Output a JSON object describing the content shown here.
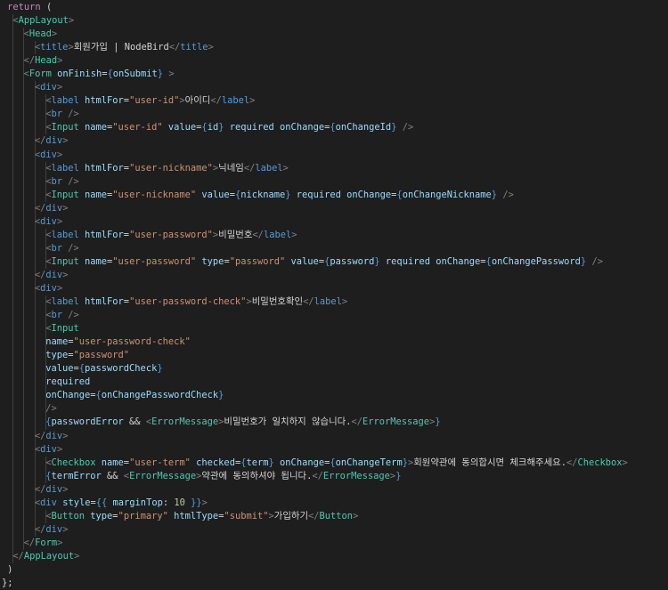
{
  "lines": [
    {
      "indent": 0.5,
      "tokens": [
        [
          "kw",
          "return"
        ],
        [
          "punc",
          " ("
        ]
      ]
    },
    {
      "indent": 1,
      "tokens": [
        [
          "ang",
          "<"
        ],
        [
          "tag",
          "AppLayout"
        ],
        [
          "ang",
          ">"
        ]
      ]
    },
    {
      "indent": 2,
      "tokens": [
        [
          "ang",
          "<"
        ],
        [
          "tag",
          "Head"
        ],
        [
          "ang",
          ">"
        ]
      ]
    },
    {
      "indent": 3,
      "tokens": [
        [
          "ang",
          "<"
        ],
        [
          "htag",
          "title"
        ],
        [
          "ang",
          ">"
        ],
        [
          "txt",
          "회원가입 | NodeBird"
        ],
        [
          "ang",
          "</"
        ],
        [
          "htag",
          "title"
        ],
        [
          "ang",
          ">"
        ]
      ]
    },
    {
      "indent": 2,
      "tokens": [
        [
          "ang",
          "</"
        ],
        [
          "tag",
          "Head"
        ],
        [
          "ang",
          ">"
        ]
      ]
    },
    {
      "indent": 2,
      "tokens": [
        [
          "ang",
          "<"
        ],
        [
          "tag",
          "Form"
        ],
        [
          "txt",
          " "
        ],
        [
          "attr",
          "onFinish"
        ],
        [
          "punc",
          "="
        ],
        [
          "brace",
          "{"
        ],
        [
          "var",
          "onSubmit"
        ],
        [
          "brace",
          "}"
        ],
        [
          "txt",
          " "
        ],
        [
          "ang",
          ">"
        ]
      ]
    },
    {
      "indent": 3,
      "tokens": [
        [
          "ang",
          "<"
        ],
        [
          "htag",
          "div"
        ],
        [
          "ang",
          ">"
        ]
      ]
    },
    {
      "indent": 4,
      "tokens": [
        [
          "ang",
          "<"
        ],
        [
          "htag",
          "label"
        ],
        [
          "txt",
          " "
        ],
        [
          "attr",
          "htmlFor"
        ],
        [
          "punc",
          "="
        ],
        [
          "str",
          "\"user-id\""
        ],
        [
          "ang",
          ">"
        ],
        [
          "txt",
          "아이디"
        ],
        [
          "ang",
          "</"
        ],
        [
          "htag",
          "label"
        ],
        [
          "ang",
          ">"
        ]
      ]
    },
    {
      "indent": 4,
      "tokens": [
        [
          "ang",
          "<"
        ],
        [
          "htag",
          "br"
        ],
        [
          "txt",
          " "
        ],
        [
          "ang",
          "/>"
        ]
      ]
    },
    {
      "indent": 4,
      "tokens": [
        [
          "ang",
          "<"
        ],
        [
          "tag",
          "Input"
        ],
        [
          "txt",
          " "
        ],
        [
          "attr",
          "name"
        ],
        [
          "punc",
          "="
        ],
        [
          "str",
          "\"user-id\""
        ],
        [
          "txt",
          " "
        ],
        [
          "attr",
          "value"
        ],
        [
          "punc",
          "="
        ],
        [
          "brace",
          "{"
        ],
        [
          "var",
          "id"
        ],
        [
          "brace",
          "}"
        ],
        [
          "txt",
          " "
        ],
        [
          "attr",
          "required"
        ],
        [
          "txt",
          " "
        ],
        [
          "attr",
          "onChange"
        ],
        [
          "punc",
          "="
        ],
        [
          "brace",
          "{"
        ],
        [
          "var",
          "onChangeId"
        ],
        [
          "brace",
          "}"
        ],
        [
          "txt",
          " "
        ],
        [
          "ang",
          "/>"
        ]
      ]
    },
    {
      "indent": 3,
      "tokens": [
        [
          "ang",
          "</"
        ],
        [
          "htag",
          "div"
        ],
        [
          "ang",
          ">"
        ]
      ]
    },
    {
      "indent": 3,
      "tokens": [
        [
          "ang",
          "<"
        ],
        [
          "htag",
          "div"
        ],
        [
          "ang",
          ">"
        ]
      ]
    },
    {
      "indent": 4,
      "tokens": [
        [
          "ang",
          "<"
        ],
        [
          "htag",
          "label"
        ],
        [
          "txt",
          " "
        ],
        [
          "attr",
          "htmlFor"
        ],
        [
          "punc",
          "="
        ],
        [
          "str",
          "\"user-nickname\""
        ],
        [
          "ang",
          ">"
        ],
        [
          "txt",
          "닉네임"
        ],
        [
          "ang",
          "</"
        ],
        [
          "htag",
          "label"
        ],
        [
          "ang",
          ">"
        ]
      ]
    },
    {
      "indent": 4,
      "tokens": [
        [
          "ang",
          "<"
        ],
        [
          "htag",
          "br"
        ],
        [
          "txt",
          " "
        ],
        [
          "ang",
          "/>"
        ]
      ]
    },
    {
      "indent": 4,
      "tokens": [
        [
          "ang",
          "<"
        ],
        [
          "tag",
          "Input"
        ],
        [
          "txt",
          " "
        ],
        [
          "attr",
          "name"
        ],
        [
          "punc",
          "="
        ],
        [
          "str",
          "\"user-nickname\""
        ],
        [
          "txt",
          " "
        ],
        [
          "attr",
          "value"
        ],
        [
          "punc",
          "="
        ],
        [
          "brace",
          "{"
        ],
        [
          "var",
          "nickname"
        ],
        [
          "brace",
          "}"
        ],
        [
          "txt",
          " "
        ],
        [
          "attr",
          "required"
        ],
        [
          "txt",
          " "
        ],
        [
          "attr",
          "onChange"
        ],
        [
          "punc",
          "="
        ],
        [
          "brace",
          "{"
        ],
        [
          "var",
          "onChangeNickname"
        ],
        [
          "brace",
          "}"
        ],
        [
          "txt",
          " "
        ],
        [
          "ang",
          "/>"
        ]
      ]
    },
    {
      "indent": 3,
      "tokens": [
        [
          "ang",
          "</"
        ],
        [
          "htag",
          "div"
        ],
        [
          "ang",
          ">"
        ]
      ]
    },
    {
      "indent": 3,
      "tokens": [
        [
          "ang",
          "<"
        ],
        [
          "htag",
          "div"
        ],
        [
          "ang",
          ">"
        ]
      ]
    },
    {
      "indent": 4,
      "tokens": [
        [
          "ang",
          "<"
        ],
        [
          "htag",
          "label"
        ],
        [
          "txt",
          " "
        ],
        [
          "attr",
          "htmlFor"
        ],
        [
          "punc",
          "="
        ],
        [
          "str",
          "\"user-password\""
        ],
        [
          "ang",
          ">"
        ],
        [
          "txt",
          "비밀번호"
        ],
        [
          "ang",
          "</"
        ],
        [
          "htag",
          "label"
        ],
        [
          "ang",
          ">"
        ]
      ]
    },
    {
      "indent": 4,
      "tokens": [
        [
          "ang",
          "<"
        ],
        [
          "htag",
          "br"
        ],
        [
          "txt",
          " "
        ],
        [
          "ang",
          "/>"
        ]
      ]
    },
    {
      "indent": 4,
      "tokens": [
        [
          "ang",
          "<"
        ],
        [
          "tag",
          "Input"
        ],
        [
          "txt",
          " "
        ],
        [
          "attr",
          "name"
        ],
        [
          "punc",
          "="
        ],
        [
          "str",
          "\"user-password\""
        ],
        [
          "txt",
          " "
        ],
        [
          "attr",
          "type"
        ],
        [
          "punc",
          "="
        ],
        [
          "str",
          "\"password\""
        ],
        [
          "txt",
          " "
        ],
        [
          "attr",
          "value"
        ],
        [
          "punc",
          "="
        ],
        [
          "brace",
          "{"
        ],
        [
          "var",
          "password"
        ],
        [
          "brace",
          "}"
        ],
        [
          "txt",
          " "
        ],
        [
          "attr",
          "required"
        ],
        [
          "txt",
          " "
        ],
        [
          "attr",
          "onChange"
        ],
        [
          "punc",
          "="
        ],
        [
          "brace",
          "{"
        ],
        [
          "var",
          "onChangePassword"
        ],
        [
          "brace",
          "}"
        ],
        [
          "txt",
          " "
        ],
        [
          "ang",
          "/>"
        ]
      ]
    },
    {
      "indent": 3,
      "tokens": [
        [
          "ang",
          "</"
        ],
        [
          "htag",
          "div"
        ],
        [
          "ang",
          ">"
        ]
      ]
    },
    {
      "indent": 3,
      "tokens": [
        [
          "ang",
          "<"
        ],
        [
          "htag",
          "div"
        ],
        [
          "ang",
          ">"
        ]
      ]
    },
    {
      "indent": 4,
      "tokens": [
        [
          "ang",
          "<"
        ],
        [
          "htag",
          "label"
        ],
        [
          "txt",
          " "
        ],
        [
          "attr",
          "htmlFor"
        ],
        [
          "punc",
          "="
        ],
        [
          "str",
          "\"user-password-check\""
        ],
        [
          "ang",
          ">"
        ],
        [
          "txt",
          "비밀번호확인"
        ],
        [
          "ang",
          "</"
        ],
        [
          "htag",
          "label"
        ],
        [
          "ang",
          ">"
        ]
      ]
    },
    {
      "indent": 4,
      "tokens": [
        [
          "ang",
          "<"
        ],
        [
          "htag",
          "br"
        ],
        [
          "txt",
          " "
        ],
        [
          "ang",
          "/>"
        ]
      ]
    },
    {
      "indent": 4,
      "tokens": [
        [
          "ang",
          "<"
        ],
        [
          "tag",
          "Input"
        ]
      ]
    },
    {
      "indent": 4,
      "tokens": [
        [
          "attr",
          "name"
        ],
        [
          "punc",
          "="
        ],
        [
          "str",
          "\"user-password-check\""
        ]
      ]
    },
    {
      "indent": 4,
      "tokens": [
        [
          "attr",
          "type"
        ],
        [
          "punc",
          "="
        ],
        [
          "str",
          "\"password\""
        ]
      ]
    },
    {
      "indent": 4,
      "tokens": [
        [
          "attr",
          "value"
        ],
        [
          "punc",
          "="
        ],
        [
          "brace",
          "{"
        ],
        [
          "var",
          "passwordCheck"
        ],
        [
          "brace",
          "}"
        ]
      ]
    },
    {
      "indent": 4,
      "tokens": [
        [
          "attr",
          "required"
        ]
      ]
    },
    {
      "indent": 4,
      "tokens": [
        [
          "attr",
          "onChange"
        ],
        [
          "punc",
          "="
        ],
        [
          "brace",
          "{"
        ],
        [
          "var",
          "onChangePasswordCheck"
        ],
        [
          "brace",
          "}"
        ]
      ]
    },
    {
      "indent": 4,
      "tokens": [
        [
          "ang",
          "/>"
        ]
      ]
    },
    {
      "indent": 4,
      "tokens": [
        [
          "brace",
          "{"
        ],
        [
          "var",
          "passwordError"
        ],
        [
          "txt",
          " && "
        ],
        [
          "ang",
          "<"
        ],
        [
          "tag",
          "ErrorMessage"
        ],
        [
          "ang",
          ">"
        ],
        [
          "txt",
          "비밀번호가 일치하지 않습니다."
        ],
        [
          "ang",
          "</"
        ],
        [
          "tag",
          "ErrorMessage"
        ],
        [
          "ang",
          ">"
        ],
        [
          "brace",
          "}"
        ]
      ]
    },
    {
      "indent": 3,
      "tokens": [
        [
          "ang",
          "</"
        ],
        [
          "htag",
          "div"
        ],
        [
          "ang",
          ">"
        ]
      ]
    },
    {
      "indent": 3,
      "tokens": [
        [
          "ang",
          "<"
        ],
        [
          "htag",
          "div"
        ],
        [
          "ang",
          ">"
        ]
      ]
    },
    {
      "indent": 4,
      "tokens": [
        [
          "ang",
          "<"
        ],
        [
          "tag",
          "Checkbox"
        ],
        [
          "txt",
          " "
        ],
        [
          "attr",
          "name"
        ],
        [
          "punc",
          "="
        ],
        [
          "str",
          "\"user-term\""
        ],
        [
          "txt",
          " "
        ],
        [
          "attr",
          "checked"
        ],
        [
          "punc",
          "="
        ],
        [
          "brace",
          "{"
        ],
        [
          "var",
          "term"
        ],
        [
          "brace",
          "}"
        ],
        [
          "txt",
          " "
        ],
        [
          "attr",
          "onChange"
        ],
        [
          "punc",
          "="
        ],
        [
          "brace",
          "{"
        ],
        [
          "var",
          "onChangeTerm"
        ],
        [
          "brace",
          "}"
        ],
        [
          "ang",
          ">"
        ],
        [
          "txt",
          "회원약관에 동의합시면 체크해주세요."
        ],
        [
          "ang",
          "</"
        ],
        [
          "tag",
          "Checkbox"
        ],
        [
          "ang",
          ">"
        ]
      ]
    },
    {
      "indent": 4,
      "tokens": [
        [
          "brace",
          "{"
        ],
        [
          "var",
          "termError"
        ],
        [
          "txt",
          " && "
        ],
        [
          "ang",
          "<"
        ],
        [
          "tag",
          "ErrorMessage"
        ],
        [
          "ang",
          ">"
        ],
        [
          "txt",
          "약관에 동의하셔야 됩니다."
        ],
        [
          "ang",
          "</"
        ],
        [
          "tag",
          "ErrorMessage"
        ],
        [
          "ang",
          ">"
        ],
        [
          "brace",
          "}"
        ]
      ]
    },
    {
      "indent": 3,
      "tokens": [
        [
          "ang",
          "</"
        ],
        [
          "htag",
          "div"
        ],
        [
          "ang",
          ">"
        ]
      ]
    },
    {
      "indent": 3,
      "tokens": [
        [
          "ang",
          "<"
        ],
        [
          "htag",
          "div"
        ],
        [
          "txt",
          " "
        ],
        [
          "attr",
          "style"
        ],
        [
          "punc",
          "="
        ],
        [
          "brace",
          "{{"
        ],
        [
          "txt",
          " "
        ],
        [
          "var",
          "marginTop"
        ],
        [
          "punc",
          ": "
        ],
        [
          "num",
          "10"
        ],
        [
          "txt",
          " "
        ],
        [
          "brace",
          "}}"
        ],
        [
          "ang",
          ">"
        ]
      ]
    },
    {
      "indent": 4,
      "tokens": [
        [
          "ang",
          "<"
        ],
        [
          "tag",
          "Button"
        ],
        [
          "txt",
          " "
        ],
        [
          "attr",
          "type"
        ],
        [
          "punc",
          "="
        ],
        [
          "str",
          "\"primary\""
        ],
        [
          "txt",
          " "
        ],
        [
          "attr",
          "htmlType"
        ],
        [
          "punc",
          "="
        ],
        [
          "str",
          "\"submit\""
        ],
        [
          "ang",
          ">"
        ],
        [
          "txt",
          "가입하기"
        ],
        [
          "ang",
          "</"
        ],
        [
          "tag",
          "Button"
        ],
        [
          "ang",
          ">"
        ]
      ]
    },
    {
      "indent": 3,
      "tokens": [
        [
          "ang",
          "</"
        ],
        [
          "htag",
          "div"
        ],
        [
          "ang",
          ">"
        ]
      ]
    },
    {
      "indent": 2,
      "tokens": [
        [
          "ang",
          "</"
        ],
        [
          "tag",
          "Form"
        ],
        [
          "ang",
          ">"
        ]
      ]
    },
    {
      "indent": 1,
      "tokens": [
        [
          "ang",
          "</"
        ],
        [
          "tag",
          "AppLayout"
        ],
        [
          "ang",
          ">"
        ]
      ]
    },
    {
      "indent": 0.5,
      "tokens": [
        [
          "punc",
          ")"
        ]
      ]
    },
    {
      "indent": 0,
      "tokens": [
        [
          "punc",
          "};"
        ]
      ]
    }
  ]
}
